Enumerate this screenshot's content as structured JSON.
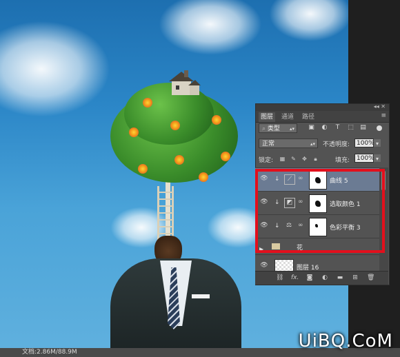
{
  "layers_panel": {
    "tabs": [
      "图层",
      "通道",
      "路径"
    ],
    "active_tab": 0,
    "filter_kind": "类型",
    "blend_mode": "正常",
    "opacity_label": "不透明度:",
    "opacity_value": "100%",
    "lock_label": "锁定:",
    "fill_label": "填充:",
    "fill_value": "100%",
    "layers": [
      {
        "name": "曲线 5",
        "type": "curves",
        "icon": "curves-icon",
        "selected": true
      },
      {
        "name": "选取颜色 1",
        "type": "selective-color",
        "icon": "selective-color-icon",
        "selected": false
      },
      {
        "name": "色彩平衡 3",
        "type": "color-balance",
        "icon": "color-balance-icon",
        "selected": false
      },
      {
        "name": "花",
        "type": "group",
        "icon": "folder-icon",
        "selected": false
      },
      {
        "name": "图层 16",
        "type": "pixel",
        "icon": "pixel-layer-thumbnail",
        "selected": false
      }
    ],
    "footer_icons": [
      "link-icon",
      "fx-icon",
      "mask-icon",
      "adjustment-icon",
      "folder-icon",
      "new-layer-icon",
      "trash-icon"
    ],
    "highlight_color": "#e30f1c"
  },
  "status": {
    "doc_info": "文档:2.86M/88.9M"
  },
  "watermark": "UiBQ.CoM"
}
